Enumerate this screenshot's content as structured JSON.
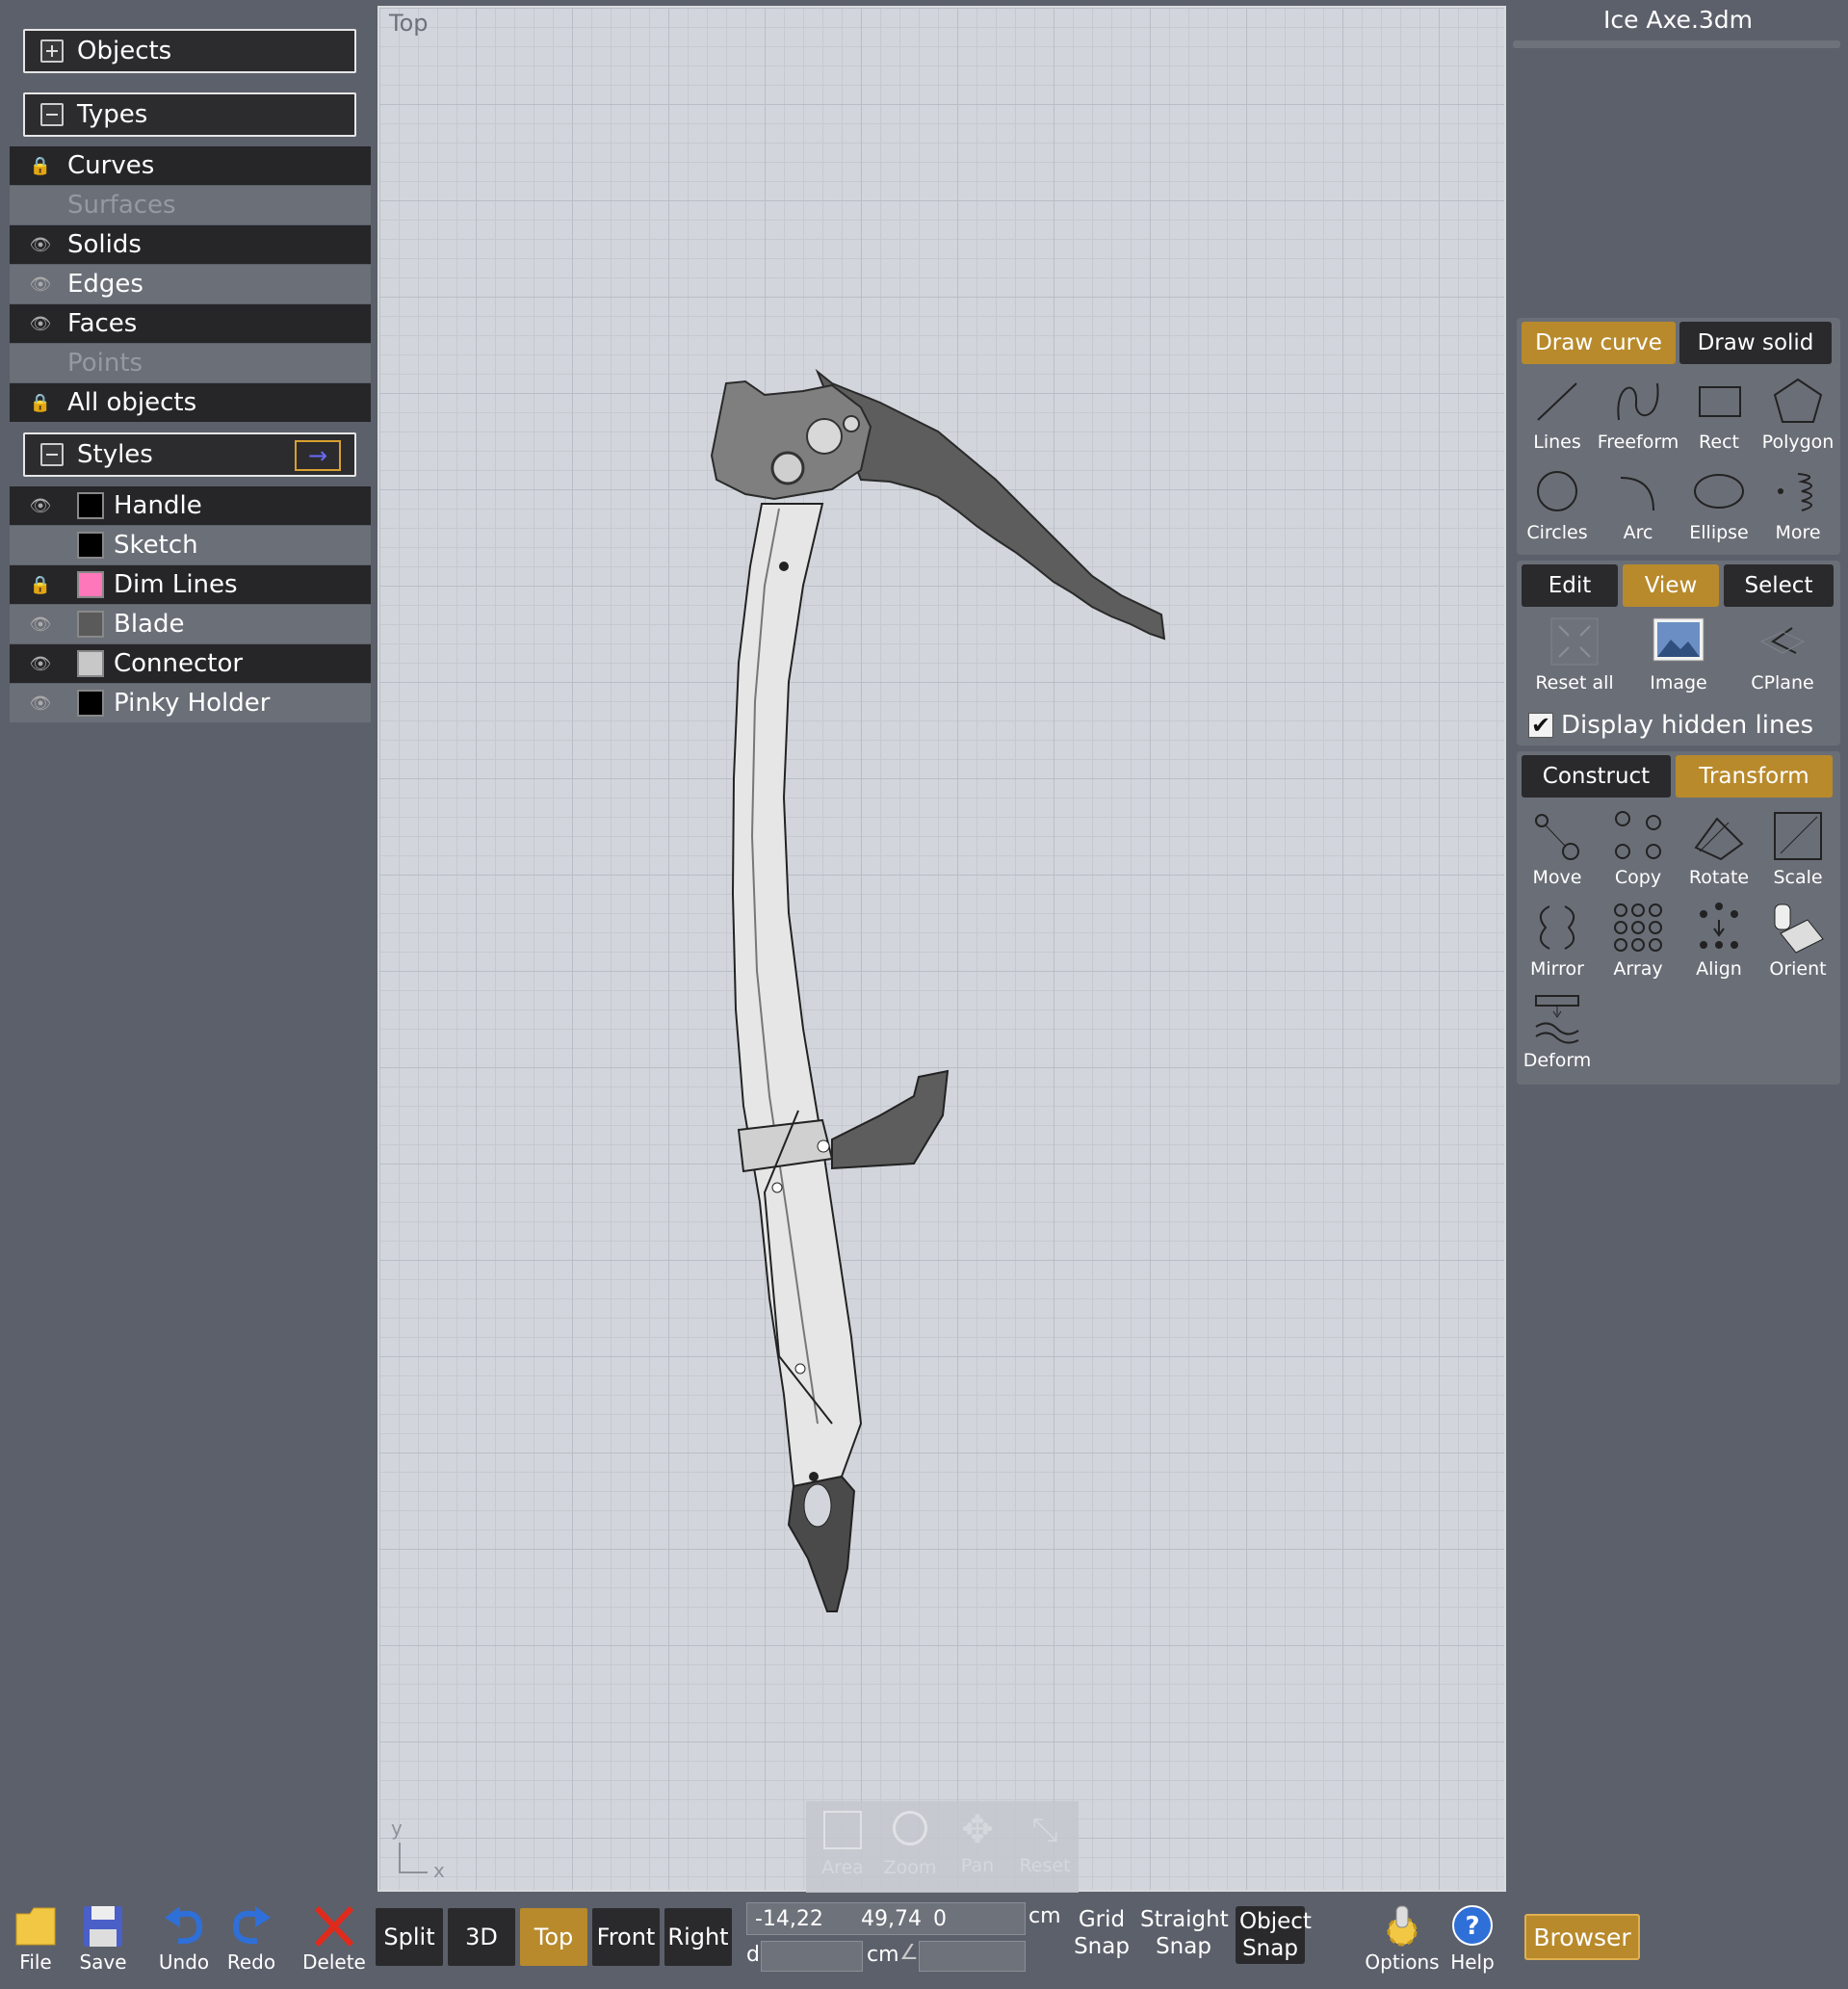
{
  "window": {
    "title": "Ice Axe.3dm"
  },
  "left_panel": {
    "objects_header": "Objects",
    "types_header": "Types",
    "types": [
      {
        "label": "Curves",
        "state": "locked"
      },
      {
        "label": "Surfaces",
        "state": "disabled"
      },
      {
        "label": "Solids",
        "state": "visible"
      },
      {
        "label": "Edges",
        "state": "visible"
      },
      {
        "label": "Faces",
        "state": "visible"
      },
      {
        "label": "Points",
        "state": "disabled"
      },
      {
        "label": "All objects",
        "state": "locked"
      }
    ],
    "styles_header": "Styles",
    "styles": [
      {
        "label": "Handle",
        "color": "#000000",
        "state": "visible"
      },
      {
        "label": "Sketch",
        "color": "#000000",
        "state": "none"
      },
      {
        "label": "Dim Lines",
        "color": "#ff77bb",
        "state": "locked"
      },
      {
        "label": "Blade",
        "color": "#5a5a5a",
        "state": "visible"
      },
      {
        "label": "Connector",
        "color": "#c8c8c8",
        "state": "visible"
      },
      {
        "label": "Pinky Holder",
        "color": "#000000",
        "state": "visible"
      }
    ]
  },
  "viewport": {
    "label": "Top",
    "axis_y": "y",
    "axis_x": "x",
    "nav": [
      "Area",
      "Zoom",
      "Pan",
      "Reset"
    ]
  },
  "right_panel": {
    "draw_tabs": [
      "Draw curve",
      "Draw solid"
    ],
    "draw_tools": [
      "Lines",
      "Freeform",
      "Rect",
      "Polygon",
      "Circles",
      "Arc",
      "Ellipse",
      "More"
    ],
    "mode_tabs": [
      "Edit",
      "View",
      "Select"
    ],
    "view_tools": [
      "Reset all",
      "Image",
      "CPlane"
    ],
    "display_hidden_lines": "Display hidden lines",
    "transform_tabs": [
      "Construct",
      "Transform"
    ],
    "transform_tools": [
      "Move",
      "Copy",
      "Rotate",
      "Scale",
      "Mirror",
      "Array",
      "Align",
      "Orient",
      "Deform"
    ]
  },
  "bottom_bar": {
    "file": "File",
    "save": "Save",
    "undo": "Undo",
    "redo": "Redo",
    "delete": "Delete",
    "views": [
      "Split",
      "3D",
      "Top",
      "Front",
      "Right"
    ],
    "active_view": "Top",
    "coord_x": "-14,22",
    "coord_y": "49,74",
    "coord_z": "0",
    "unit": "cm",
    "d_label": "d",
    "angle_symbol": "∠",
    "grid_snap": [
      "Grid",
      "Snap"
    ],
    "straight_snap": [
      "Straight",
      "Snap"
    ],
    "object_snap": [
      "Object",
      "Snap"
    ],
    "options": "Options",
    "help": "Help",
    "browser": "Browser"
  },
  "colors": {
    "accent": "#b88a2c",
    "panel": "#5c606b",
    "dark": "#262628"
  }
}
